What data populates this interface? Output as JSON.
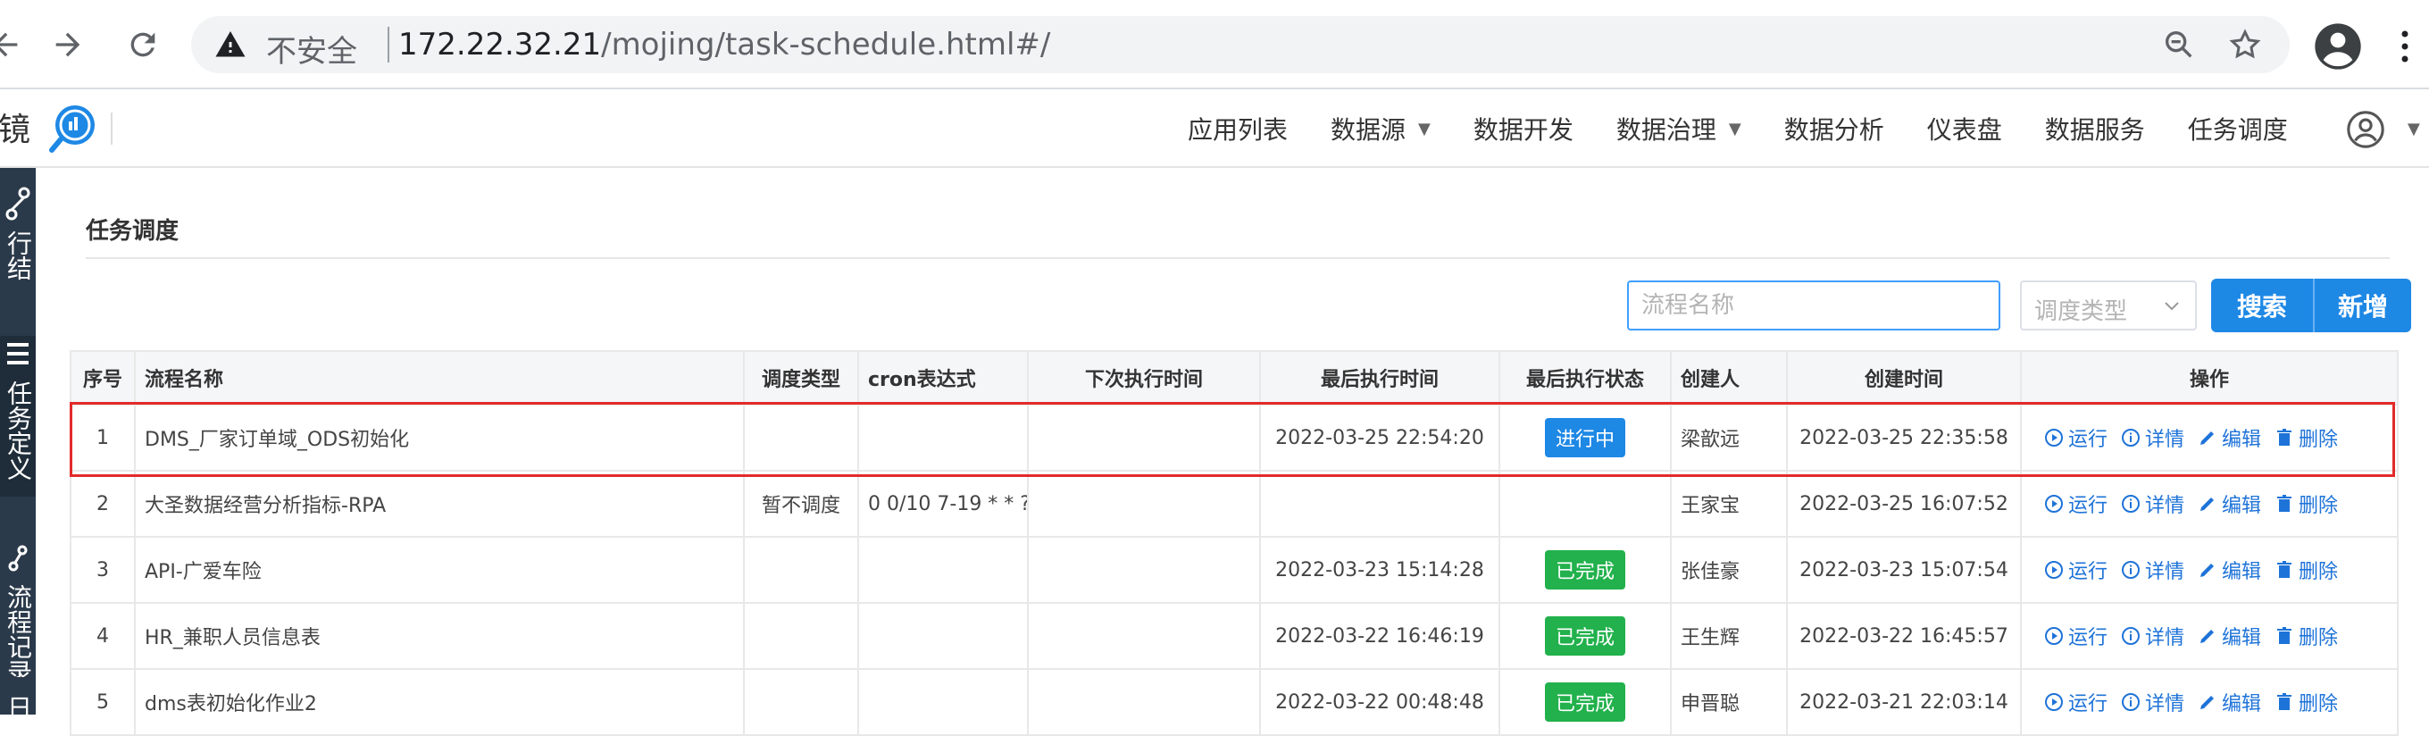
{
  "browser": {
    "insecure_label": "不安全",
    "url_host": "172.22.32.21",
    "url_path": "/mojing/task-schedule.html#/"
  },
  "app": {
    "logo_text": "魔镜",
    "nav": [
      {
        "label": "应用列表",
        "dropdown": false
      },
      {
        "label": "数据源",
        "dropdown": true
      },
      {
        "label": "数据开发",
        "dropdown": false
      },
      {
        "label": "数据治理",
        "dropdown": true
      },
      {
        "label": "数据分析",
        "dropdown": false
      },
      {
        "label": "仪表盘",
        "dropdown": false
      },
      {
        "label": "数据服务",
        "dropdown": false
      },
      {
        "label": "任务调度",
        "dropdown": false
      }
    ],
    "caret": "▼"
  },
  "sidebar": [
    {
      "label": "行结",
      "icon": "flow-icon"
    },
    {
      "label": "任务定义",
      "icon": "list-icon"
    },
    {
      "label": "流程记录",
      "icon": "record-icon"
    },
    {
      "label": "日",
      "icon": "log-icon"
    }
  ],
  "page": {
    "title": "任务调度",
    "search_placeholder": "流程名称",
    "type_placeholder": "调度类型",
    "search_btn": "搜索",
    "add_btn": "新增"
  },
  "table": {
    "headers": [
      "序号",
      "流程名称",
      "调度类型",
      "cron表达式",
      "下次执行时间",
      "最后执行时间",
      "最后执行状态",
      "创建人",
      "创建时间",
      "操作"
    ],
    "op_labels": [
      "运行",
      "详情",
      "编辑",
      "删除"
    ],
    "rows": [
      {
        "no": "1",
        "name": "DMS_厂家订单域_ODS初始化",
        "type": "",
        "cron": "",
        "next": "",
        "last": "2022-03-25 22:54:20",
        "status": "进行中",
        "status_kind": "running",
        "creator": "梁歆远",
        "created": "2022-03-25 22:35:58"
      },
      {
        "no": "2",
        "name": "大圣数据经营分析指标-RPA",
        "type": "暂不调度",
        "cron": "0 0/10 7-19 * * ?",
        "next": "",
        "last": "",
        "status": "",
        "status_kind": "",
        "creator": "王家宝",
        "created": "2022-03-25 16:07:52"
      },
      {
        "no": "3",
        "name": "API-广爱车险",
        "type": "",
        "cron": "",
        "next": "",
        "last": "2022-03-23 15:14:28",
        "status": "已完成",
        "status_kind": "done",
        "creator": "张佳豪",
        "created": "2022-03-23 15:07:54"
      },
      {
        "no": "4",
        "name": "HR_兼职人员信息表",
        "type": "",
        "cron": "",
        "next": "",
        "last": "2022-03-22 16:46:19",
        "status": "已完成",
        "status_kind": "done",
        "creator": "王生辉",
        "created": "2022-03-22 16:45:57"
      },
      {
        "no": "5",
        "name": "dms表初始化作业2",
        "type": "",
        "cron": "",
        "next": "",
        "last": "2022-03-22 00:48:48",
        "status": "已完成",
        "status_kind": "done",
        "creator": "申晋聪",
        "created": "2022-03-21 22:03:14"
      }
    ]
  },
  "colors": {
    "primary": "#1e88e5",
    "running": "#1e88e5",
    "done": "#22b14c",
    "highlight": "#e32a2a",
    "link": "#1e73d8"
  }
}
